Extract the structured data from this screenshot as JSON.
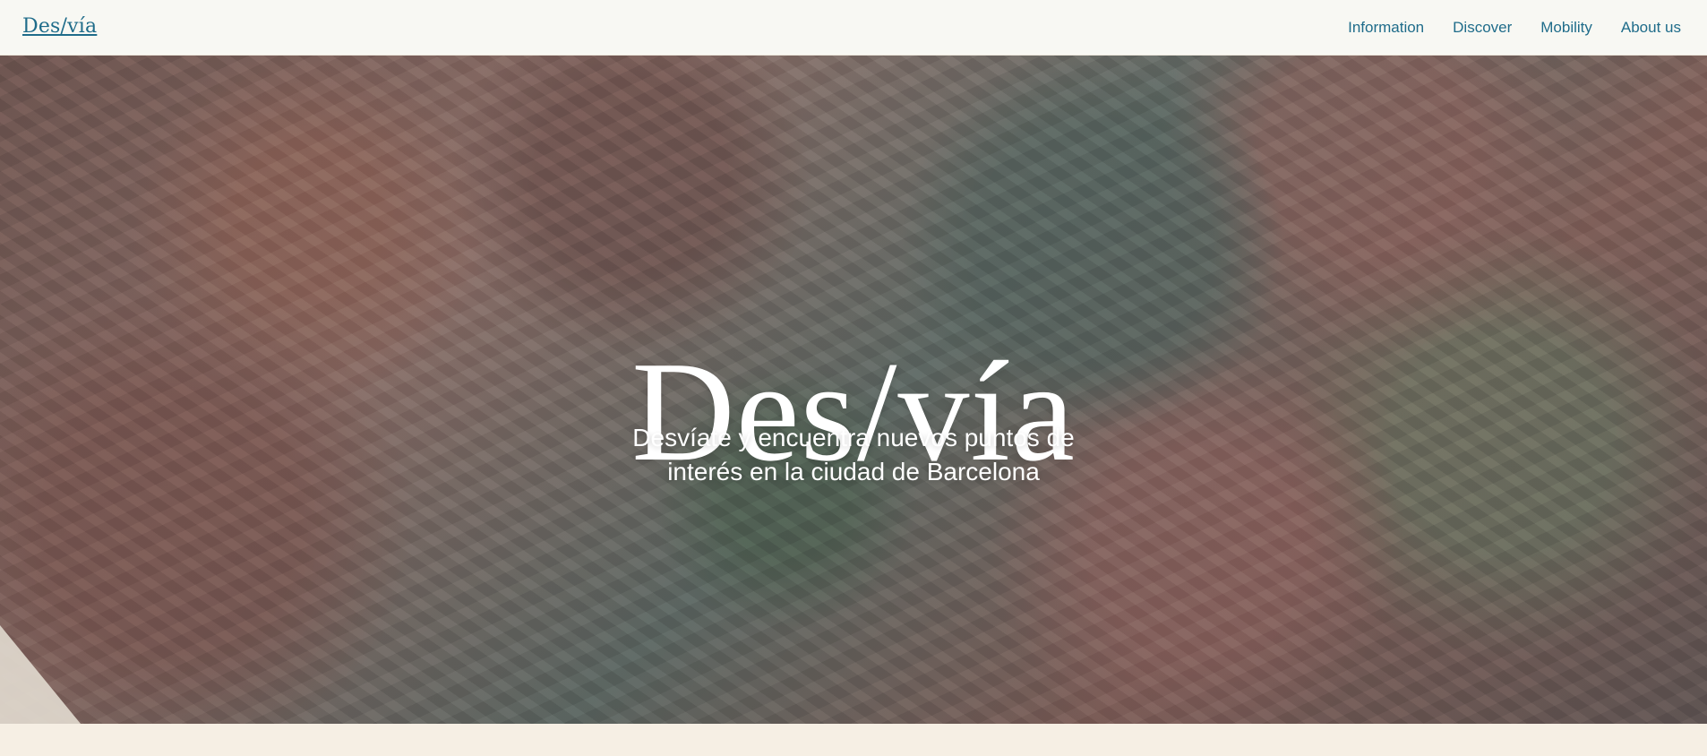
{
  "header": {
    "brand": "Des/vía",
    "nav": [
      {
        "label": "Information"
      },
      {
        "label": "Discover"
      },
      {
        "label": "Mobility"
      },
      {
        "label": "About us"
      }
    ]
  },
  "hero": {
    "title": "Des/vía",
    "subtitle": "Desvíate y encuentra nuevos puntos de interés en la ciudad de Barcelona"
  },
  "colors": {
    "brand": "#1f6c8a",
    "header_bg": "#f8f8f3",
    "page_bg": "#f6efe4",
    "hero_text": "#ffffff"
  }
}
